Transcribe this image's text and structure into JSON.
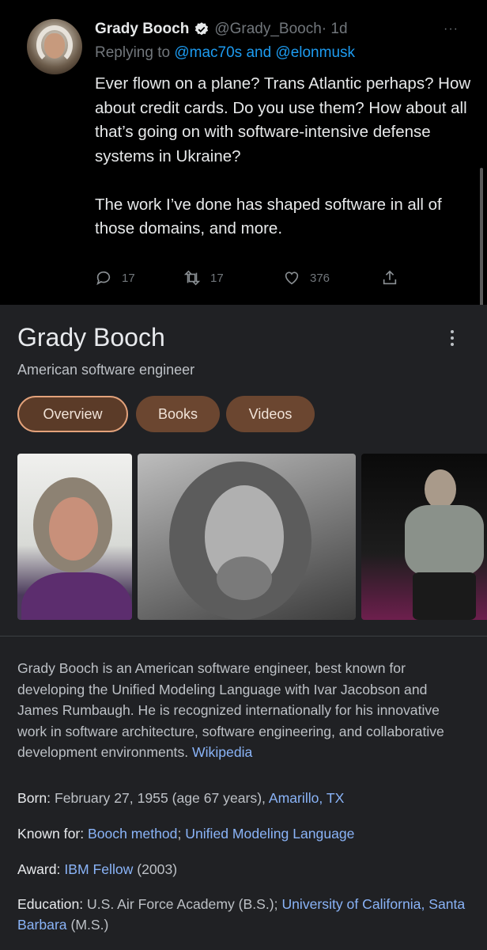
{
  "tweet": {
    "author_name": "Grady Booch",
    "handle": "@Grady_Booch",
    "time": "· 1d",
    "more": "···",
    "replying_prefix": "Replying to",
    "reply_targets": "@mac70s and @elonmusk",
    "paragraphs": [
      "Ever flown on a plane? Trans Atlantic perhaps? How about credit cards. Do you use them? How about all that’s going on with software-intensive defense systems in Ukraine?",
      "The work I’ve done has shaped software in all of those domains, and more."
    ],
    "replies": "17",
    "retweets": "17",
    "likes": "376"
  },
  "panel": {
    "title": "Grady Booch",
    "subtitle": "American software engineer",
    "chips": [
      "Overview",
      "Books",
      "Videos"
    ],
    "description": "Grady Booch is an American software engineer, best known for developing the Unified Modeling Language with Ivar Jacobson and James Rumbaugh. He is recognized internationally for his innovative work in software architecture, software engineering, and collaborative development environments.",
    "source_link": "Wikipedia",
    "facts": {
      "born_label": "Born:",
      "born_value": "February 27, 1955 (age 67 years),",
      "born_place": "Amarillo, TX",
      "known_label": "Known for:",
      "known_1": "Booch method",
      "known_sep": ";",
      "known_2": "Unified Modeling Language",
      "award_label": "Award:",
      "award_link": "IBM Fellow",
      "award_year": "(2003)",
      "edu_label": "Education:",
      "edu_1": "U.S. Air Force Academy (B.S.);",
      "edu_2a": "University of",
      "edu_2b": "California, Santa Barbara",
      "edu_2_deg": "(M.S.)"
    }
  },
  "colors": {
    "link_blue_twitter": "#1d9bf0",
    "link_blue_google": "#8ab4f8",
    "chip_brown": "#6b4630",
    "panel_bg": "#202124"
  }
}
